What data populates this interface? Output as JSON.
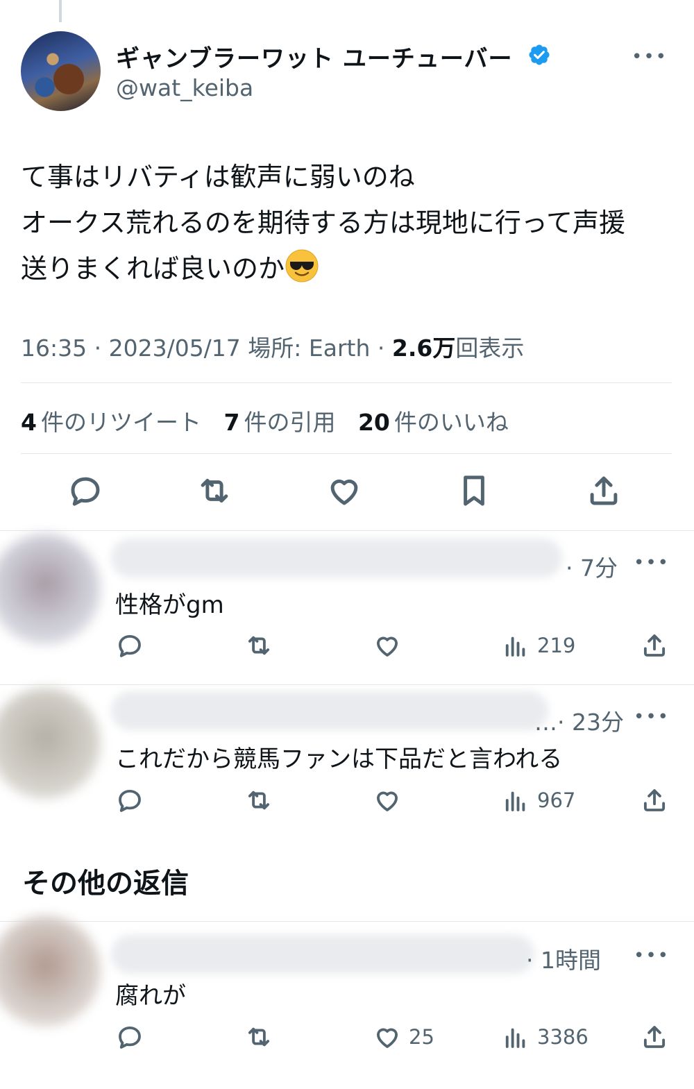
{
  "tweet": {
    "display_name": "ギャンブラーワット ユーチューバー",
    "handle": "@wat_keiba",
    "more_icon": "more-horizontal-icon",
    "text_lines": [
      "て事はリバティは歓声に弱いのね",
      "オークス荒れるのを期待する方は現地に行って声援",
      "送りまくれば良いのか"
    ],
    "emoji": "smiling-face-with-sunglasses",
    "time": "16:35",
    "date": "2023/05/17",
    "location": "場所: Earth",
    "views_count": "2.6万",
    "views_label": "回表示",
    "retweets_count": "4",
    "retweets_label": "件のリツイート",
    "quotes_count": "7",
    "quotes_label": "件の引用",
    "likes_count": "20",
    "likes_label": "件のいいね",
    "accent_color": "#1d9bf0"
  },
  "replies": [
    {
      "time": "· 7分",
      "text": "性格がgm",
      "likes": "",
      "views": "219"
    },
    {
      "time": "…· 23分",
      "text": "これだから競馬ファンは下品だと言われる",
      "likes": "",
      "views": "967"
    }
  ],
  "more_replies_title": "その他の返信",
  "more_replies": [
    {
      "time": "· 1時間",
      "text": "腐れが",
      "likes": "25",
      "views": "3386"
    }
  ]
}
